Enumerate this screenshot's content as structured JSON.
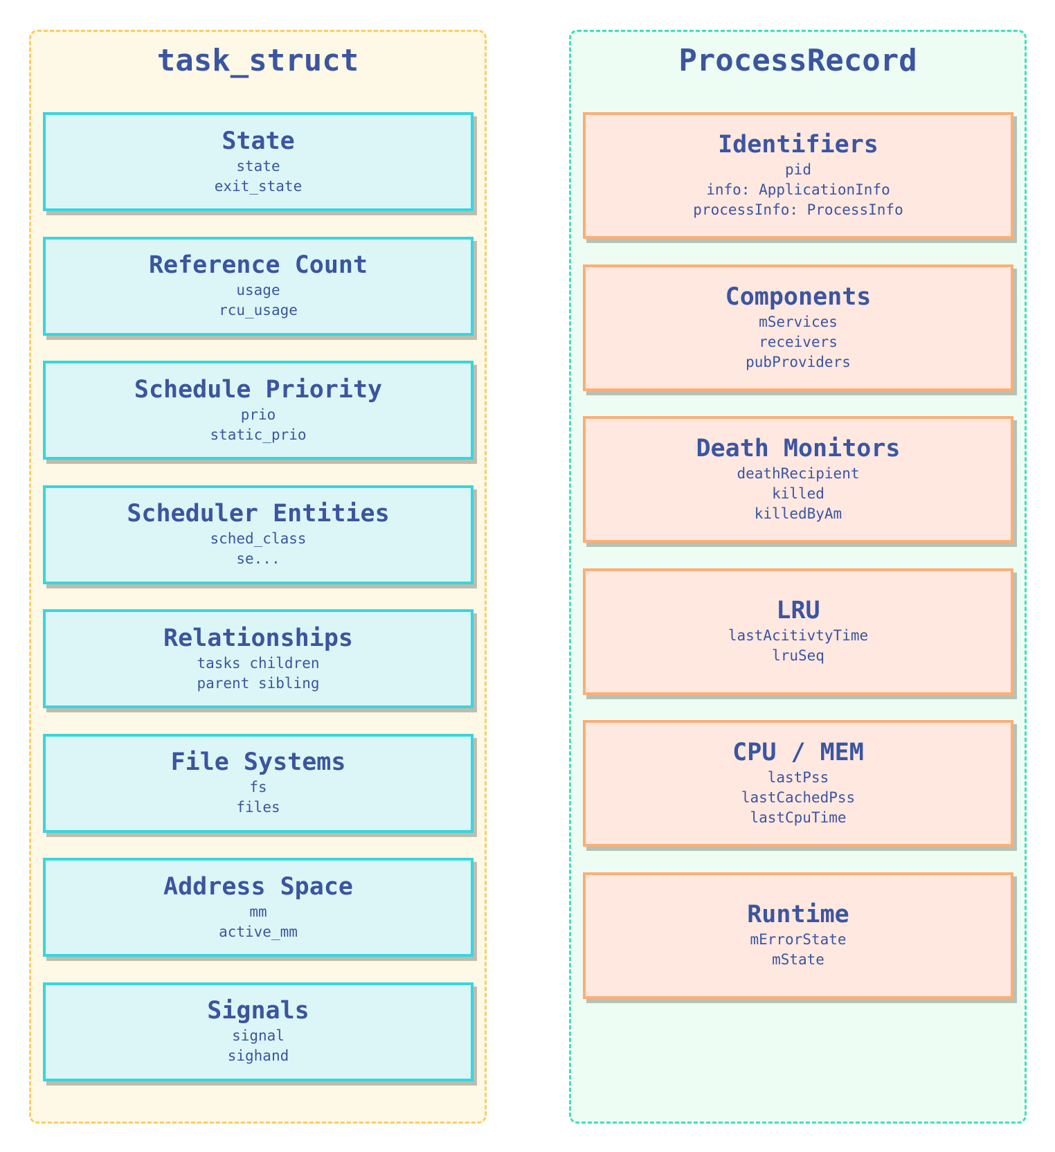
{
  "colors": {
    "text": "#3b55a0",
    "left_group_bg": "#fef8e6",
    "left_group_border": "#fdcd5c",
    "left_box_bg": "#dcf6f7",
    "left_box_border": "#36d6e0",
    "right_group_bg": "#edfdf4",
    "right_group_border": "#3ee0bb",
    "right_box_bg": "#fee8e0",
    "right_box_border": "#fcae76"
  },
  "groups": [
    {
      "title": "task_struct",
      "boxes": [
        {
          "title": "State",
          "fields": [
            "state",
            "exit_state"
          ]
        },
        {
          "title": "Reference Count",
          "fields": [
            "usage",
            "rcu_usage"
          ]
        },
        {
          "title": "Schedule Priority",
          "fields": [
            "prio",
            "static_prio"
          ]
        },
        {
          "title": "Scheduler Entities",
          "fields": [
            "sched_class",
            "se..."
          ]
        },
        {
          "title": "Relationships",
          "fields": [
            "tasks children",
            "parent sibling"
          ]
        },
        {
          "title": "File Systems",
          "fields": [
            "fs",
            "files"
          ]
        },
        {
          "title": "Address Space",
          "fields": [
            "mm",
            "active_mm"
          ]
        },
        {
          "title": "Signals",
          "fields": [
            "signal",
            "sighand"
          ]
        }
      ]
    },
    {
      "title": "ProcessRecord",
      "boxes": [
        {
          "title": "Identifiers",
          "fields": [
            "pid",
            "info: ApplicationInfo",
            "processInfo: ProcessInfo"
          ]
        },
        {
          "title": "Components",
          "fields": [
            "mServices",
            "receivers",
            "pubProviders"
          ]
        },
        {
          "title": "Death Monitors",
          "fields": [
            "deathRecipient",
            "killed",
            "killedByAm"
          ]
        },
        {
          "title": "LRU",
          "fields": [
            "lastAcitivtyTime",
            "lruSeq"
          ]
        },
        {
          "title": "CPU / MEM",
          "fields": [
            "lastPss",
            "lastCachedPss",
            "lastCpuTime"
          ]
        },
        {
          "title": "Runtime",
          "fields": [
            "mErrorState",
            "mState"
          ]
        }
      ]
    }
  ]
}
